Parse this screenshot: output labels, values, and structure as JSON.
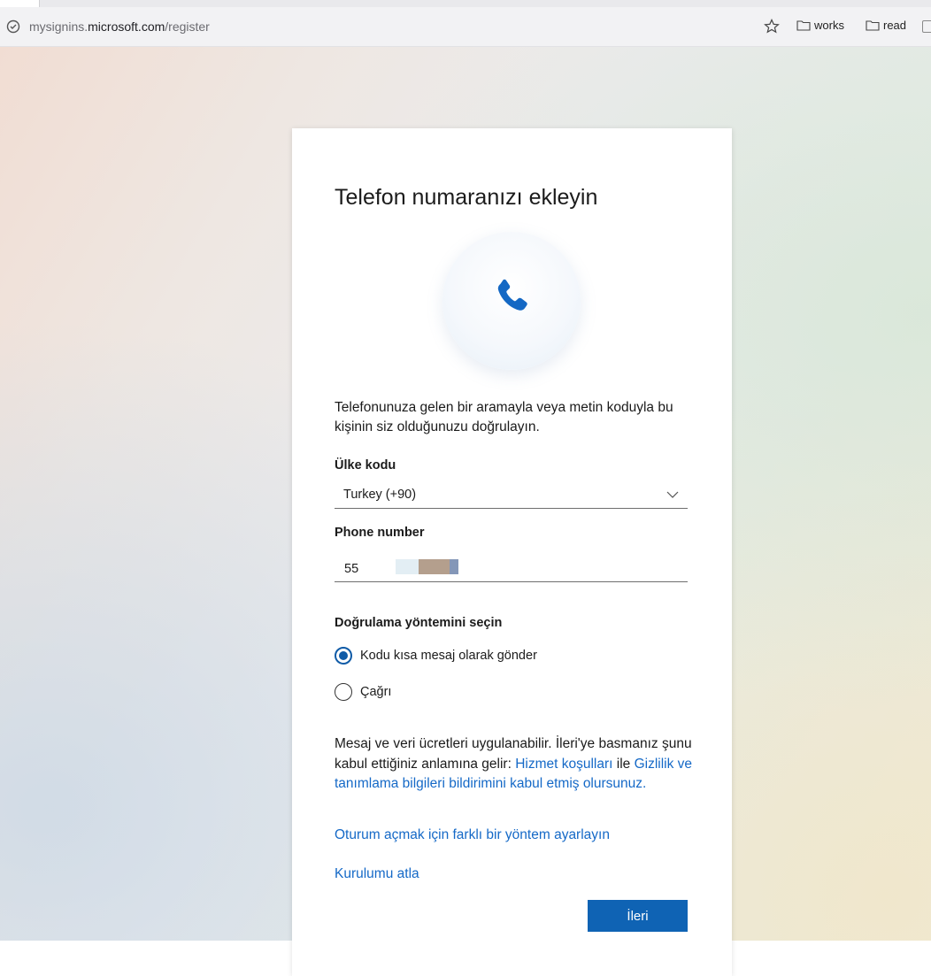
{
  "browser": {
    "url_prefix": "mysignins.",
    "url_host": "microsoft.com",
    "url_path": "/register",
    "bookmarks": [
      "works",
      "read"
    ]
  },
  "card": {
    "title": "Telefon numaranızı ekleyin",
    "description": "Telefonunuza gelen bir aramayla veya metin koduyla bu kişinin siz olduğunuzu doğrulayın.",
    "country_label": "Ülke kodu",
    "country_value": "Turkey (+90)",
    "phone_label": "Phone number",
    "phone_value_visible": "55",
    "method_label": "Doğrulama yöntemini seçin",
    "methods": [
      {
        "label": "Kodu kısa mesaj olarak gönder",
        "selected": true
      },
      {
        "label": "Çağrı",
        "selected": false
      }
    ],
    "legal_text_1": "Mesaj ve veri ücretleri uygulanabilir. İleri'ye basmanız şunu kabul ettiğiniz anlamına gelir: ",
    "legal_link_1": "Hizmet koşulları",
    "legal_text_2": " ile ",
    "legal_link_2": "Gizlilik ve tanımlama bilgileri bildirimini kabul etmiş olursunuz.",
    "alt_method_link": "Oturum açmak için farklı bir yöntem ayarlayın",
    "skip_link": "Kurulumu atla",
    "next_button": "İleri"
  },
  "colors": {
    "accent": "#0f63b4",
    "link": "#1569c7",
    "radio": "#0f5ba7"
  }
}
